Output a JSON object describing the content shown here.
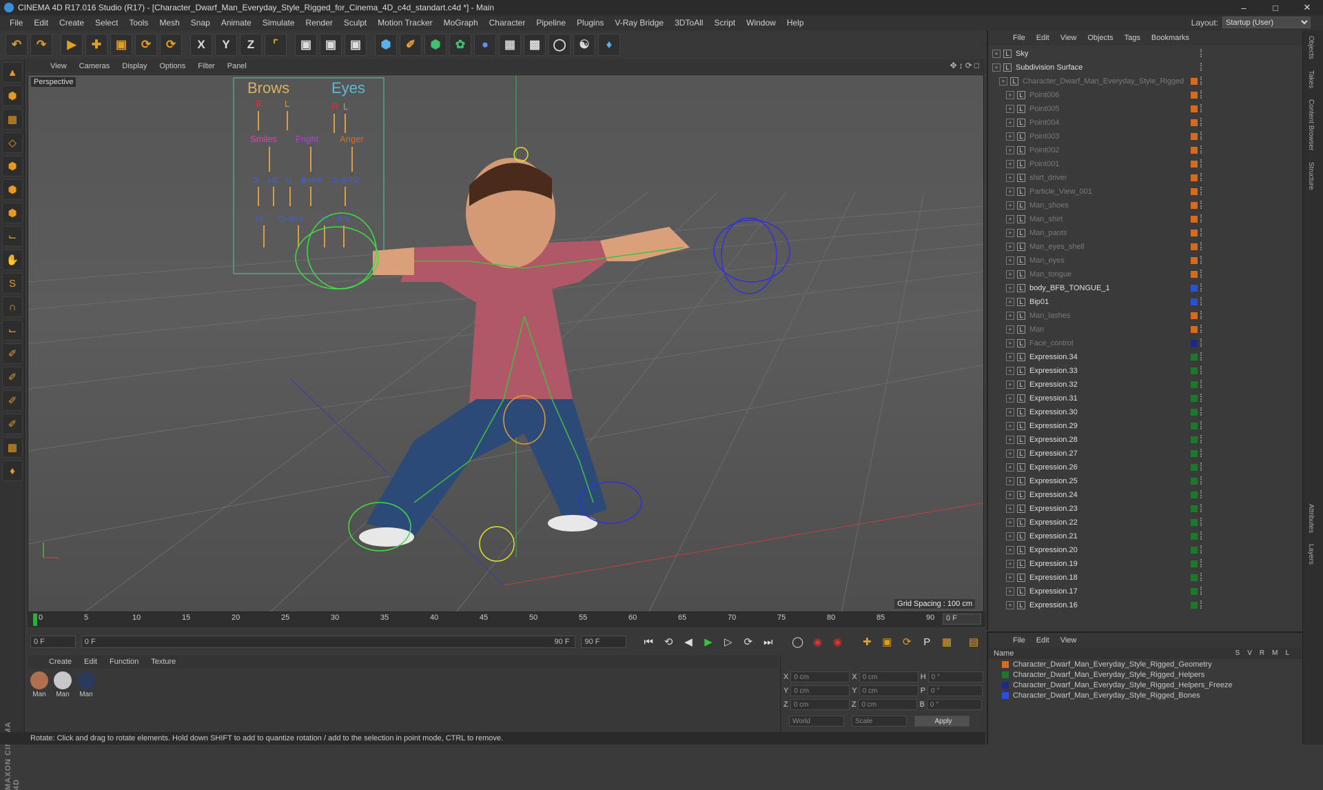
{
  "window": {
    "title": "CINEMA 4D R17.016 Studio (R17) - [Character_Dwarf_Man_Everyday_Style_Rigged_for_Cinema_4D_c4d_standart.c4d *] - Main"
  },
  "menubar": {
    "items": [
      "File",
      "Edit",
      "Create",
      "Select",
      "Tools",
      "Mesh",
      "Snap",
      "Animate",
      "Simulate",
      "Render",
      "Sculpt",
      "Motion Tracker",
      "MoGraph",
      "Character",
      "Pipeline",
      "Plugins",
      "V-Ray Bridge",
      "3DToAll",
      "Script",
      "Window",
      "Help"
    ],
    "layout_label": "Layout:",
    "layout_value": "Startup (User)"
  },
  "viewport": {
    "menu": [
      "View",
      "Cameras",
      "Display",
      "Options",
      "Filter",
      "Panel"
    ],
    "label": "Perspective",
    "grid_spacing": "Grid Spacing : 100 cm",
    "face_panel": {
      "brows": "Brows",
      "eyes": "Eyes",
      "r1": "R",
      "l1": "L",
      "r2": "R",
      "l2": "L",
      "smiles": "Smiles",
      "fright": "Fright",
      "anger": "Anger",
      "phon1": "O",
      "phon2": "I-E",
      "phon3": "U",
      "phon4": "B-M-P",
      "phon5": "D-S-T-Z",
      "phon6": "I-V",
      "phon7": "Ch-Sh-J",
      "phon8": "Th",
      "phon9": "R-W"
    }
  },
  "timeline": {
    "ticks": [
      "0",
      "5",
      "10",
      "15",
      "20",
      "25",
      "30",
      "35",
      "40",
      "45",
      "50",
      "55",
      "60",
      "65",
      "70",
      "75",
      "80",
      "85",
      "90"
    ],
    "end_field": "0 F"
  },
  "transport": {
    "start": "0 F",
    "range_start": "0 F",
    "range_end": "90 F",
    "end": "90 F"
  },
  "materials": {
    "menu": [
      "Create",
      "Edit",
      "Function",
      "Texture"
    ],
    "items": [
      {
        "label": "Man",
        "color": "#b07050"
      },
      {
        "label": "Man",
        "color": "#c8c8c8"
      },
      {
        "label": "Man",
        "color": "#2a3a5a"
      }
    ]
  },
  "coords": {
    "x": "0 cm",
    "y": "0 cm",
    "z": "0 cm",
    "x2": "0 cm",
    "y2": "0 cm",
    "z2": "0 cm",
    "h": "0 °",
    "p": "0 °",
    "b": "0 °",
    "mode": "World",
    "scale": "Scale",
    "apply": "Apply"
  },
  "status": "Rotate: Click and drag to rotate elements. Hold down SHIFT to add to quantize rotation / add to the selection in point mode, CTRL to remove.",
  "object_manager": {
    "menu": [
      "File",
      "Edit",
      "View",
      "Objects",
      "Tags",
      "Bookmarks"
    ],
    "rows": [
      {
        "name": "Sky",
        "dim": false,
        "indent": 0,
        "layer": ""
      },
      {
        "name": "Subdivision Surface",
        "dim": false,
        "indent": 0,
        "layer": ""
      },
      {
        "name": "Character_Dwarf_Man_Everyday_Style_Rigged",
        "dim": true,
        "indent": 1,
        "layer": "#d86a1a"
      },
      {
        "name": "Point006",
        "dim": true,
        "indent": 2,
        "layer": "#d86a1a"
      },
      {
        "name": "Point005",
        "dim": true,
        "indent": 2,
        "layer": "#d86a1a"
      },
      {
        "name": "Point004",
        "dim": true,
        "indent": 2,
        "layer": "#d86a1a"
      },
      {
        "name": "Point003",
        "dim": true,
        "indent": 2,
        "layer": "#d86a1a"
      },
      {
        "name": "Point002",
        "dim": true,
        "indent": 2,
        "layer": "#d86a1a"
      },
      {
        "name": "Point001",
        "dim": true,
        "indent": 2,
        "layer": "#d86a1a"
      },
      {
        "name": "shirt_driver",
        "dim": true,
        "indent": 2,
        "layer": "#d86a1a"
      },
      {
        "name": "Particle_View_001",
        "dim": true,
        "indent": 2,
        "layer": "#d86a1a"
      },
      {
        "name": "Man_shoes",
        "dim": true,
        "indent": 2,
        "layer": "#d86a1a"
      },
      {
        "name": "Man_shirt",
        "dim": true,
        "indent": 2,
        "layer": "#d86a1a"
      },
      {
        "name": "Man_pants",
        "dim": true,
        "indent": 2,
        "layer": "#d86a1a"
      },
      {
        "name": "Man_eyes_shell",
        "dim": true,
        "indent": 2,
        "layer": "#d86a1a"
      },
      {
        "name": "Man_eyes",
        "dim": true,
        "indent": 2,
        "layer": "#d86a1a"
      },
      {
        "name": "Man_tongue",
        "dim": true,
        "indent": 2,
        "layer": "#d86a1a"
      },
      {
        "name": "body_BFB_TONGUE_1",
        "dim": false,
        "indent": 2,
        "layer": "#2a4fd8"
      },
      {
        "name": "Bip01",
        "dim": false,
        "indent": 2,
        "layer": "#2a4fd8"
      },
      {
        "name": "Man_lashes",
        "dim": true,
        "indent": 2,
        "layer": "#d86a1a"
      },
      {
        "name": "Man",
        "dim": true,
        "indent": 2,
        "layer": "#d86a1a"
      },
      {
        "name": "Face_control",
        "dim": true,
        "indent": 2,
        "layer": "#1a2a8a"
      },
      {
        "name": "Expression.34",
        "dim": false,
        "indent": 2,
        "layer": "#1a7a2a"
      },
      {
        "name": "Expression.33",
        "dim": false,
        "indent": 2,
        "layer": "#1a7a2a"
      },
      {
        "name": "Expression.32",
        "dim": false,
        "indent": 2,
        "layer": "#1a7a2a"
      },
      {
        "name": "Expression.31",
        "dim": false,
        "indent": 2,
        "layer": "#1a7a2a"
      },
      {
        "name": "Expression.30",
        "dim": false,
        "indent": 2,
        "layer": "#1a7a2a"
      },
      {
        "name": "Expression.29",
        "dim": false,
        "indent": 2,
        "layer": "#1a7a2a"
      },
      {
        "name": "Expression.28",
        "dim": false,
        "indent": 2,
        "layer": "#1a7a2a"
      },
      {
        "name": "Expression.27",
        "dim": false,
        "indent": 2,
        "layer": "#1a7a2a"
      },
      {
        "name": "Expression.26",
        "dim": false,
        "indent": 2,
        "layer": "#1a7a2a"
      },
      {
        "name": "Expression.25",
        "dim": false,
        "indent": 2,
        "layer": "#1a7a2a"
      },
      {
        "name": "Expression.24",
        "dim": false,
        "indent": 2,
        "layer": "#1a7a2a"
      },
      {
        "name": "Expression.23",
        "dim": false,
        "indent": 2,
        "layer": "#1a7a2a"
      },
      {
        "name": "Expression.22",
        "dim": false,
        "indent": 2,
        "layer": "#1a7a2a"
      },
      {
        "name": "Expression.21",
        "dim": false,
        "indent": 2,
        "layer": "#1a7a2a"
      },
      {
        "name": "Expression.20",
        "dim": false,
        "indent": 2,
        "layer": "#1a7a2a"
      },
      {
        "name": "Expression.19",
        "dim": false,
        "indent": 2,
        "layer": "#1a7a2a"
      },
      {
        "name": "Expression.18",
        "dim": false,
        "indent": 2,
        "layer": "#1a7a2a"
      },
      {
        "name": "Expression.17",
        "dim": false,
        "indent": 2,
        "layer": "#1a7a2a"
      },
      {
        "name": "Expression.16",
        "dim": false,
        "indent": 2,
        "layer": "#1a7a2a"
      }
    ]
  },
  "layer_manager": {
    "menu": [
      "File",
      "Edit",
      "View"
    ],
    "header_name": "Name",
    "header_cols": "SVRML",
    "layers": [
      {
        "name": "Character_Dwarf_Man_Everyday_Style_Rigged_Geometry",
        "color": "#d86a1a"
      },
      {
        "name": "Character_Dwarf_Man_Everyday_Style_Rigged_Helpers",
        "color": "#1a7a2a"
      },
      {
        "name": "Character_Dwarf_Man_Everyday_Style_Rigged_Helpers_Freeze",
        "color": "#1a2a8a"
      },
      {
        "name": "Character_Dwarf_Man_Everyday_Style_Rigged_Bones",
        "color": "#2a4fd8"
      }
    ]
  },
  "side_tabs": [
    "Objects",
    "Takes",
    "Content Browser",
    "Structure",
    "Attributes",
    "Layers"
  ]
}
